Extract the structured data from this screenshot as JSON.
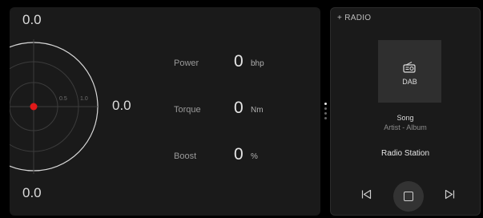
{
  "gauge": {
    "top_value": "0.0",
    "right_value": "0.0",
    "bottom_value": "0.0",
    "scale_labels": [
      "0.5",
      "1.0"
    ],
    "dot_color": "#e01919"
  },
  "metrics": [
    {
      "label": "Power",
      "value": "0",
      "unit": "bhp"
    },
    {
      "label": "Torque",
      "value": "0",
      "unit": "Nm"
    },
    {
      "label": "Boost",
      "value": "0",
      "unit": "%"
    }
  ],
  "radio": {
    "title": "+ RADIO",
    "source_label": "DAB",
    "song": "Song",
    "artist_album": "Artist - Album",
    "station": "Radio Station",
    "controls": {
      "previous_icon": "skip-previous-icon",
      "stop_icon": "stop-icon",
      "next_icon": "skip-next-icon"
    }
  }
}
